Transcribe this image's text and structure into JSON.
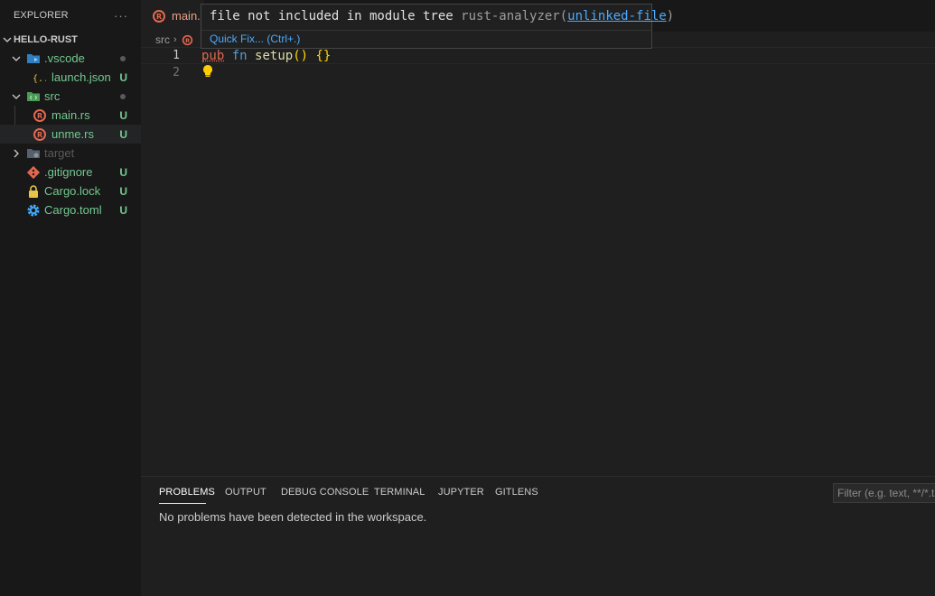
{
  "sidebar": {
    "title": "EXPLORER",
    "more": "···",
    "root": "HELLO-RUST",
    "items": [
      {
        "label": ".vscode",
        "status": ""
      },
      {
        "label": "launch.json",
        "status": "U"
      },
      {
        "label": "src",
        "status": ""
      },
      {
        "label": "main.rs",
        "status": "U"
      },
      {
        "label": "unme.rs",
        "status": "U"
      },
      {
        "label": "target",
        "status": ""
      },
      {
        "label": ".gitignore",
        "status": "U"
      },
      {
        "label": "Cargo.lock",
        "status": "U"
      },
      {
        "label": "Cargo.toml",
        "status": "U"
      }
    ]
  },
  "editor": {
    "tab_label": "main.rs",
    "breadcrumb": [
      "src"
    ],
    "lines": [
      {
        "number": "1",
        "pub": "pub",
        "fn": "fn",
        "name": "setup",
        "parens": "()",
        "braces": "{}"
      },
      {
        "number": "2"
      }
    ]
  },
  "hover": {
    "message": "file not included in module tree",
    "source": "rust-analyzer",
    "code_open": "(",
    "code": "unlinked-file",
    "code_close": ")",
    "quick_fix": "Quick Fix... (Ctrl+.)"
  },
  "panel": {
    "tabs": [
      "PROBLEMS",
      "OUTPUT",
      "DEBUG CONSOLE",
      "TERMINAL",
      "JUPYTER",
      "GITLENS"
    ],
    "filter_placeholder": "Filter (e.g. text, **/*.ts,",
    "message": "No problems have been detected in the workspace."
  },
  "colors": {
    "untracked": "#73c991",
    "rust_icon": "#e3674f",
    "link": "#4daafc",
    "background": "#1f1f1f",
    "sidebar": "#181818"
  }
}
